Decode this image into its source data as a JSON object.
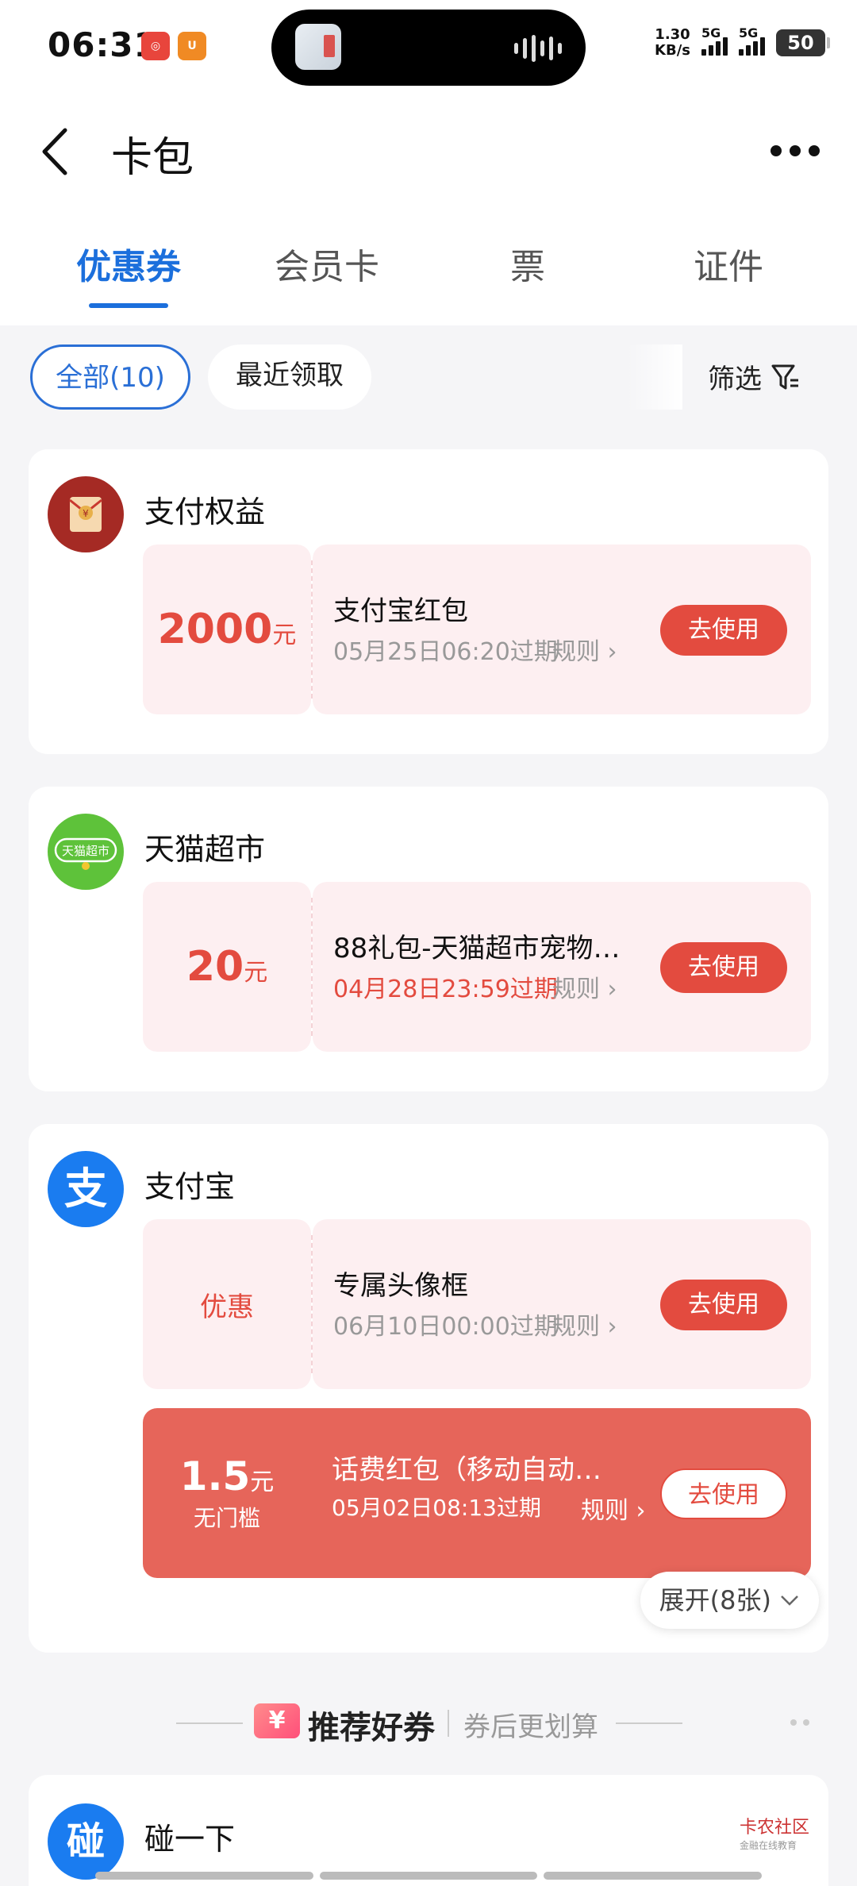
{
  "status_bar": {
    "time": "06:31",
    "net_speed_value": "1.30",
    "net_speed_unit": "KB/s",
    "signal1_label": "5G",
    "signal2_label": "5G",
    "battery": "50"
  },
  "header": {
    "title": "卡包"
  },
  "tabs": [
    {
      "label": "优惠券",
      "active": true
    },
    {
      "label": "会员卡",
      "active": false
    },
    {
      "label": "票",
      "active": false
    },
    {
      "label": "证件",
      "active": false
    }
  ],
  "filters": {
    "all_label": "全部(10)",
    "recent_label": "最近领取",
    "filter_label": "筛选"
  },
  "groups": [
    {
      "merchant": "支付权益",
      "coupons": [
        {
          "amount": "2000",
          "unit": "元",
          "title": "支付宝红包",
          "expire": "05月25日06:20过期",
          "rule": "规则",
          "action": "去使用"
        }
      ]
    },
    {
      "merchant": "天猫超市",
      "logo_text": "天猫超市",
      "coupons": [
        {
          "amount": "20",
          "unit": "元",
          "title": "88礼包-天猫超市宠物…",
          "expire": "04月28日23:59过期",
          "rule": "规则",
          "action": "去使用"
        }
      ]
    },
    {
      "merchant": "支付宝",
      "logo_text": "支",
      "coupons": [
        {
          "amount_text": "优惠",
          "title": "专属头像框",
          "expire": "06月10日00:00过期",
          "rule": "规则",
          "action": "去使用"
        },
        {
          "amount": "1.5",
          "unit": "元",
          "sub": "无门槛",
          "title": "话费红包（移动自动…",
          "expire": "05月02日08:13过期",
          "rule": "规则",
          "action": "去使用"
        }
      ],
      "expand_label": "展开(8张)"
    }
  ],
  "recommend": {
    "icon": "¥",
    "title": "推荐好券",
    "subtitle": "券后更划算"
  },
  "bottom_card": {
    "logo_text": "碰",
    "merchant": "碰一下"
  },
  "watermark": {
    "text": "卡农社区",
    "sub": "金融在线教育"
  },
  "colors": {
    "accent_blue": "#1b6fdc",
    "coupon_red": "#e34b3f",
    "coupon_bg": "#fdeff1"
  }
}
